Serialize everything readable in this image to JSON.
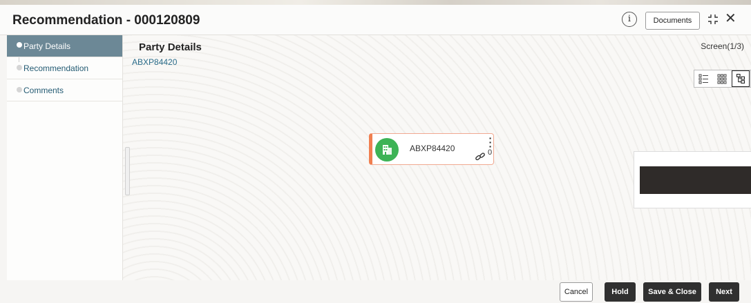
{
  "header": {
    "title": "Recommendation - 000120809",
    "info_icon": "info-icon",
    "documents_label": "Documents",
    "expand_icon": "expand-icon",
    "close_icon": "close-icon",
    "close_glyph": "✕",
    "info_glyph": "i"
  },
  "sidebar": {
    "items": [
      {
        "label": "Party Details",
        "active": true
      },
      {
        "label": "Recommendation",
        "active": false
      },
      {
        "label": "Comments",
        "active": false
      }
    ]
  },
  "main": {
    "title": "Party Details",
    "party_id": "ABXP84420",
    "screen_indicator": "Screen(1/3)",
    "view_buttons": [
      "list-view-icon",
      "grid-view-icon",
      "hierarchy-view-icon"
    ],
    "node": {
      "name": "ABXP84420",
      "icon": "building-icon",
      "link_count": "0"
    }
  },
  "footer": {
    "cancel_label": "Cancel",
    "hold_label": "Hold",
    "save_close_label": "Save & Close",
    "next_label": "Next"
  },
  "colors": {
    "active_nav": "#6c8896",
    "node_accent": "#f07f50",
    "avatar": "#3db356",
    "primary_button": "#303030",
    "link_text": "#2a6c8a"
  }
}
